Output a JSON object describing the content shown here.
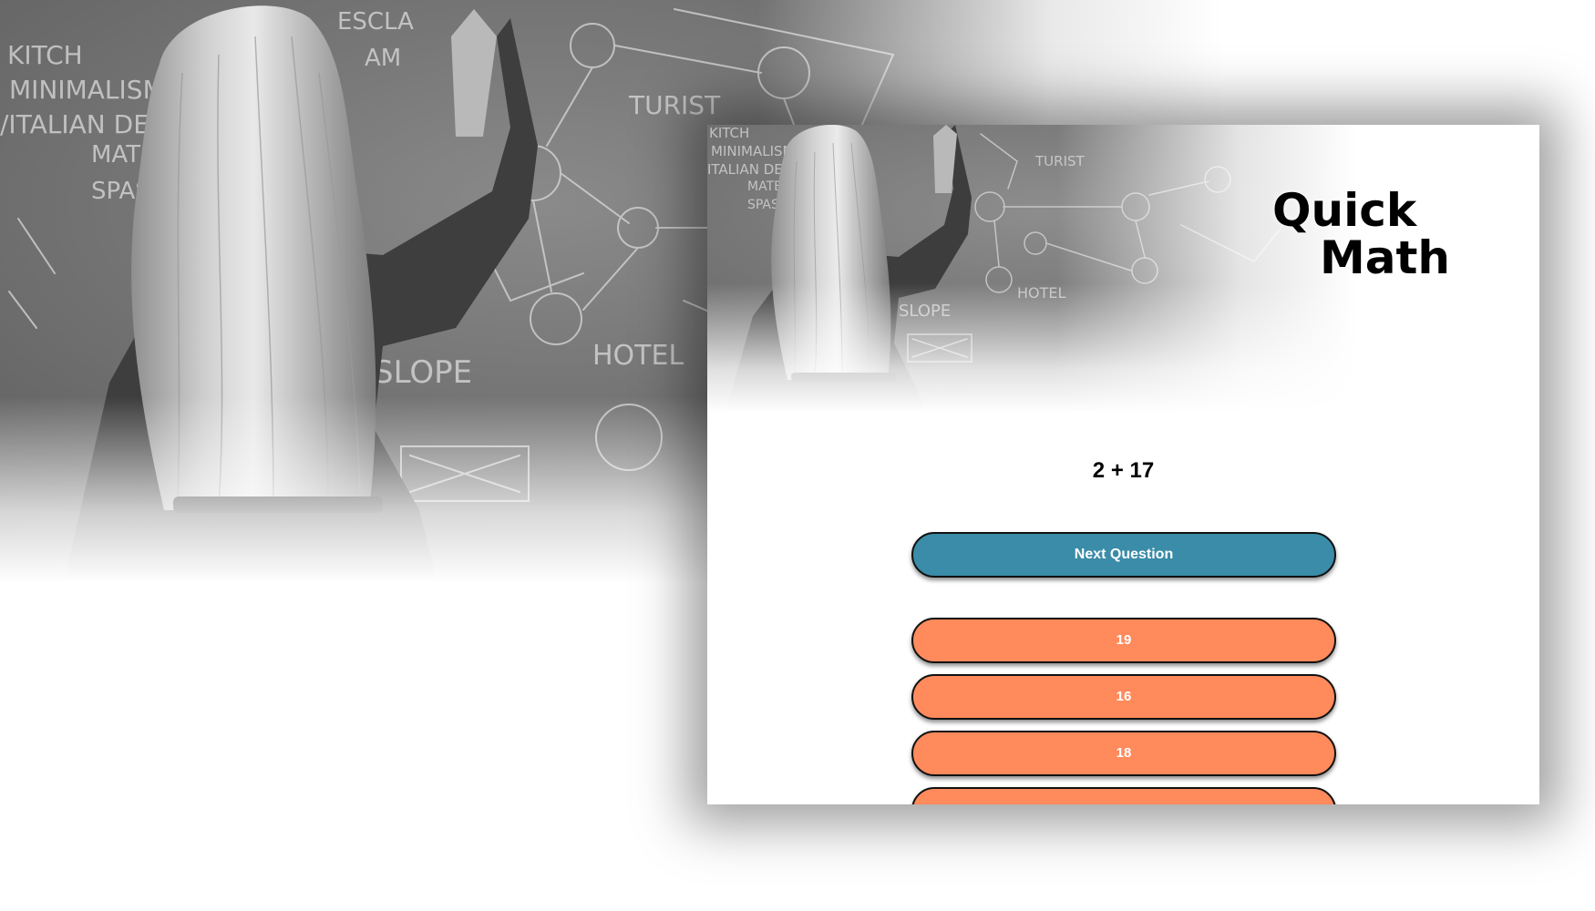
{
  "app": {
    "title_line1": "Quick",
    "title_line2": "Math"
  },
  "quiz": {
    "question": "2 + 17",
    "next_button_label": "Next Question",
    "answers": [
      "19",
      "16",
      "18",
      ""
    ]
  },
  "colors": {
    "next_button": "#3a8ca8",
    "answer_button": "#ff8a5c",
    "button_border": "#111111",
    "background": "#ffffff"
  },
  "icons": {
    "hero_image": "woman-writing-on-chalkboard-photo"
  }
}
